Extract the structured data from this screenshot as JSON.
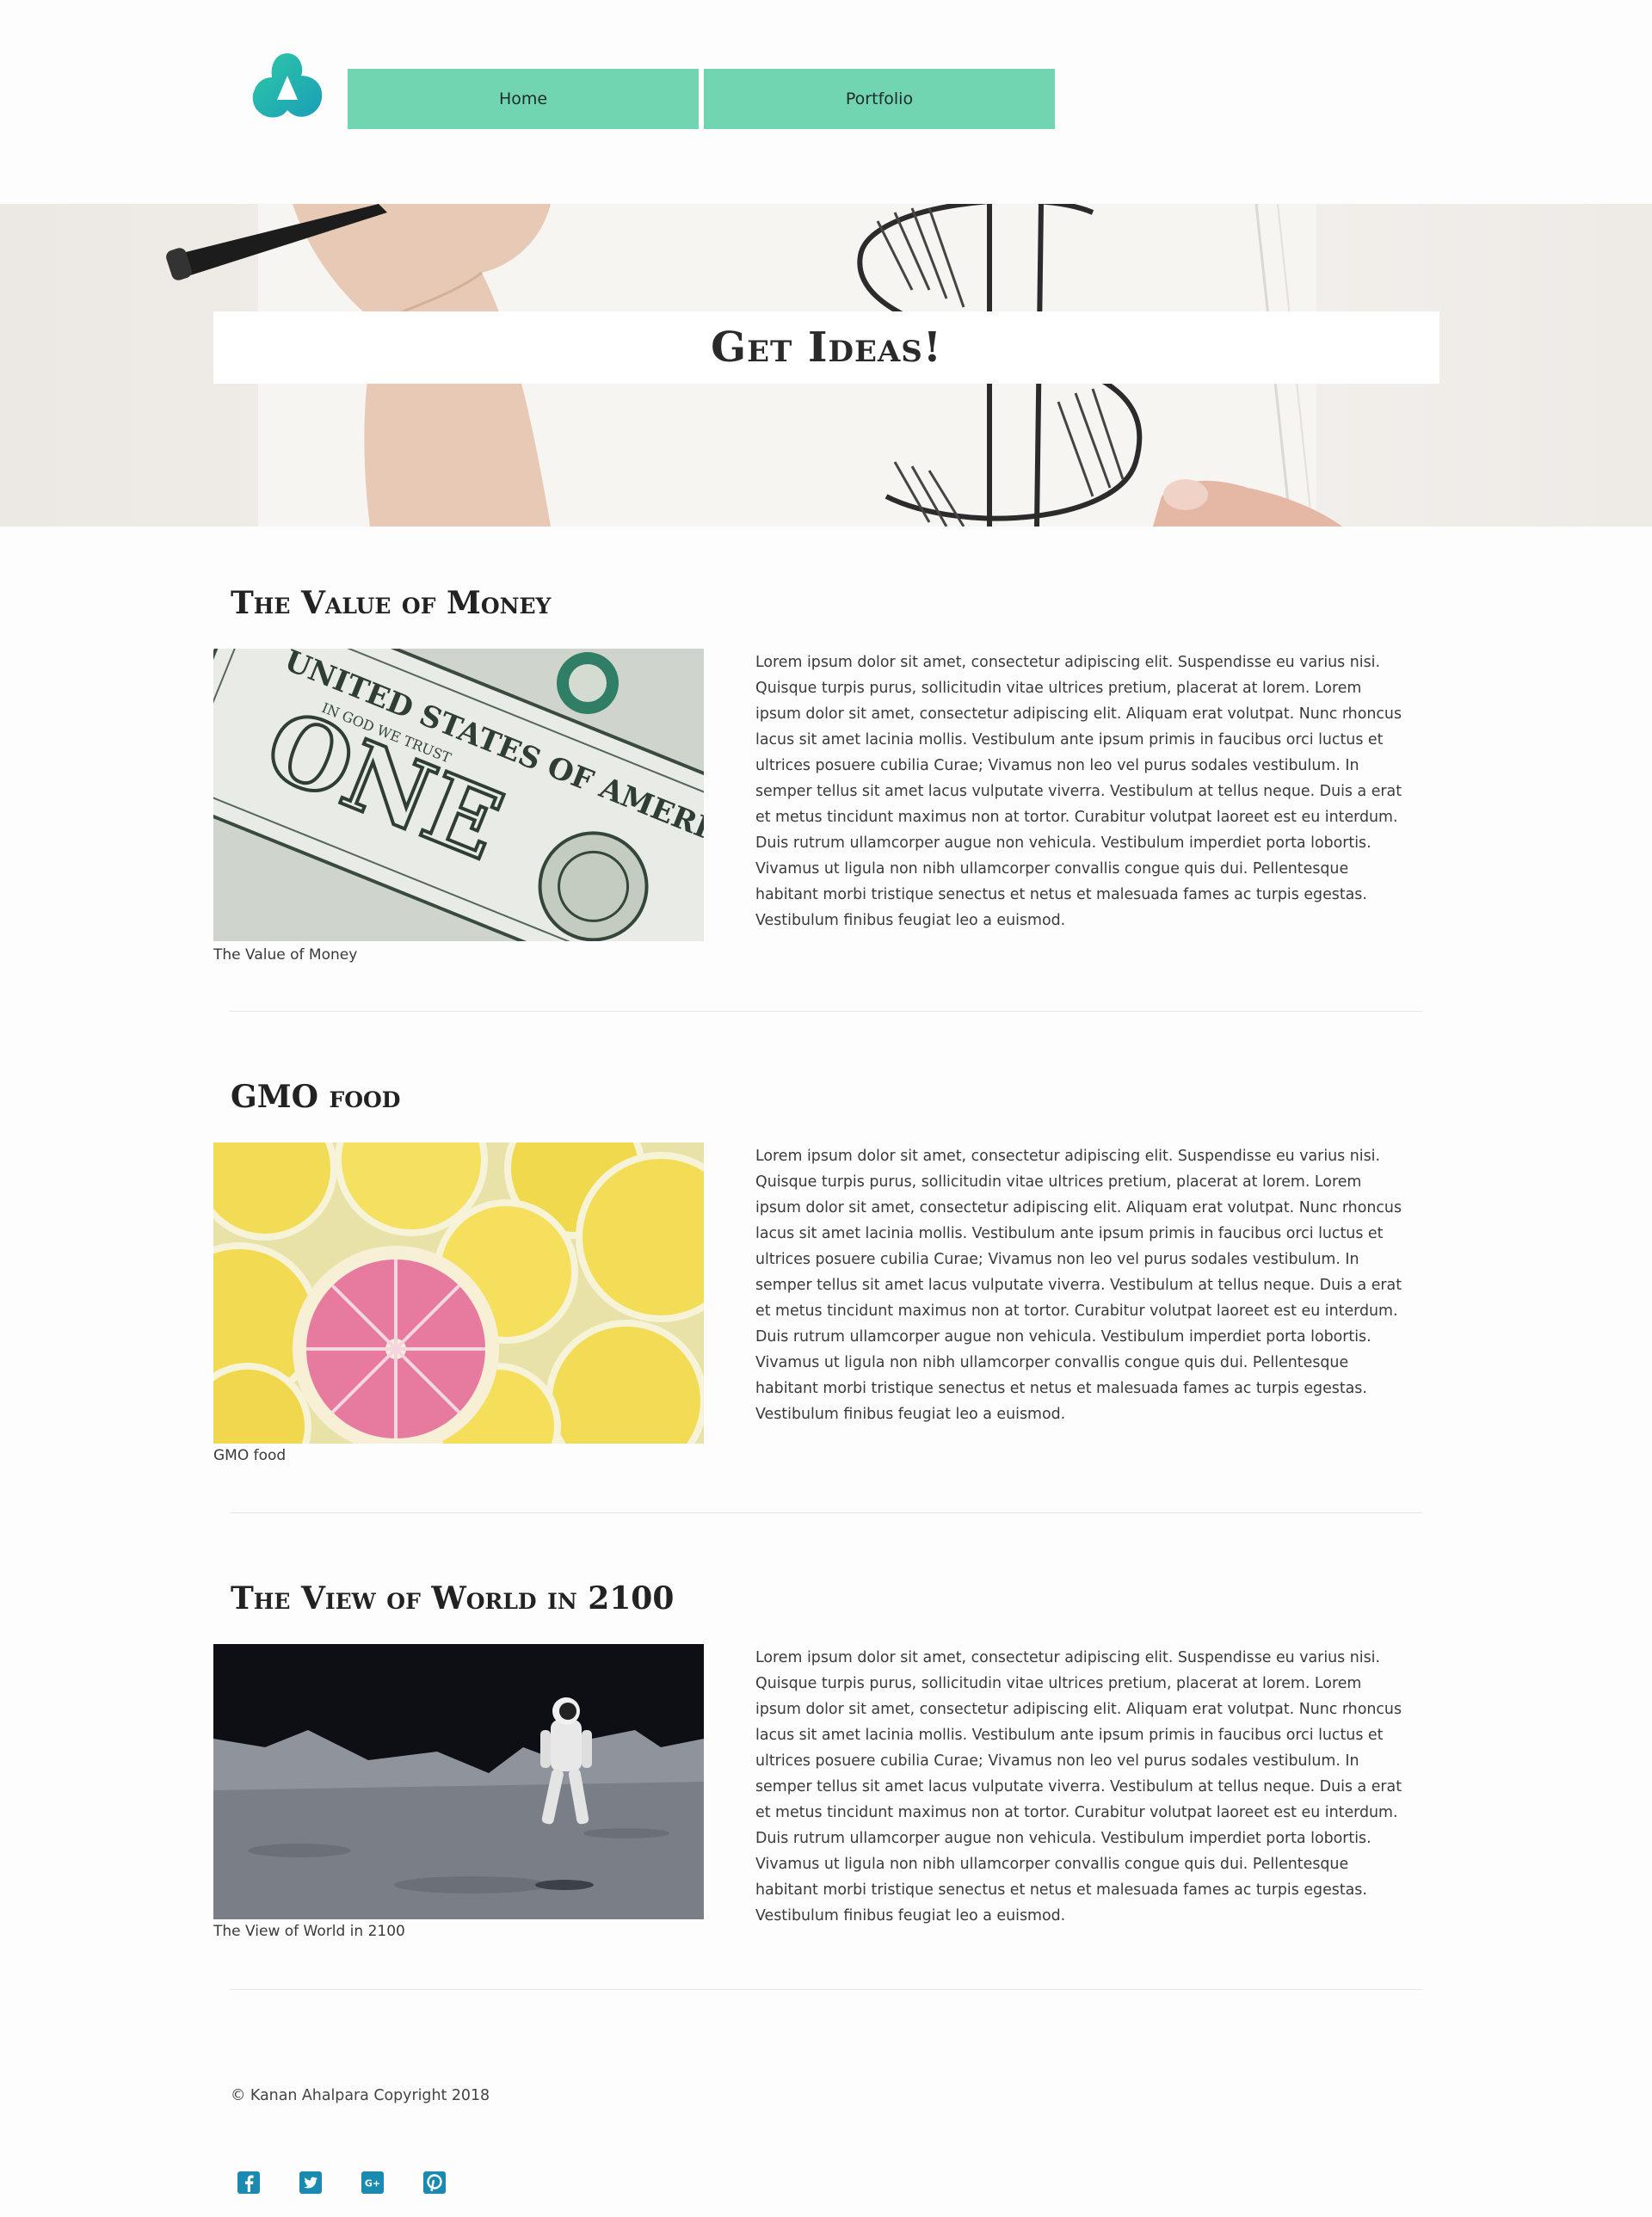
{
  "header": {
    "logo_icon": "droplet-trefoil-logo-icon",
    "nav": [
      {
        "label": "Home"
      },
      {
        "label": "Portfolio"
      }
    ]
  },
  "hero": {
    "title": "Get Ideas!",
    "background_icon": "dollar-sign-sketch-image"
  },
  "articles": [
    {
      "title": "The Value of Money",
      "image": "dollar-bill-photo",
      "caption": "The Value of Money",
      "body": "Lorem ipsum dolor sit amet, consectetur adipiscing elit. Suspendisse eu varius nisi. Quisque turpis purus, sollicitudin vitae ultrices pretium, placerat at lorem. Lorem ipsum dolor sit amet, consectetur adipiscing elit. Aliquam erat volutpat. Nunc rhoncus lacus sit amet lacinia mollis. Vestibulum ante ipsum primis in faucibus orci luctus et ultrices posuere cubilia Curae; Vivamus non leo vel purus sodales vestibulum. In semper tellus sit amet lacus vulputate viverra. Vestibulum at tellus neque. Duis a erat et metus tincidunt maximus non at tortor. Curabitur volutpat laoreet est eu interdum. Duis rutrum ullamcorper augue non vehicula. Vestibulum imperdiet porta lobortis. Vivamus ut ligula non nibh ullamcorper convallis congue quis dui. Pellentesque habitant morbi tristique senectus et netus et malesuada fames ac turpis egestas. Vestibulum finibus feugiat leo a euismod."
    },
    {
      "title": "GMO food",
      "image": "lemon-slices-photo",
      "caption": "GMO food",
      "body": "Lorem ipsum dolor sit amet, consectetur adipiscing elit. Suspendisse eu varius nisi. Quisque turpis purus, sollicitudin vitae ultrices pretium, placerat at lorem. Lorem ipsum dolor sit amet, consectetur adipiscing elit. Aliquam erat volutpat. Nunc rhoncus lacus sit amet lacinia mollis. Vestibulum ante ipsum primis in faucibus orci luctus et ultrices posuere cubilia Curae; Vivamus non leo vel purus sodales vestibulum. In semper tellus sit amet lacus vulputate viverra. Vestibulum at tellus neque. Duis a erat et metus tincidunt maximus non at tortor. Curabitur volutpat laoreet est eu interdum. Duis rutrum ullamcorper augue non vehicula. Vestibulum imperdiet porta lobortis. Vivamus ut ligula non nibh ullamcorper convallis congue quis dui. Pellentesque habitant morbi tristique senectus et netus et malesuada fames ac turpis egestas. Vestibulum finibus feugiat leo a euismod."
    },
    {
      "title": "The View of World in 2100",
      "image": "astronaut-moon-photo",
      "caption": "The View of World in 2100",
      "body": "Lorem ipsum dolor sit amet, consectetur adipiscing elit. Suspendisse eu varius nisi. Quisque turpis purus, sollicitudin vitae ultrices pretium, placerat at lorem. Lorem ipsum dolor sit amet, consectetur adipiscing elit. Aliquam erat volutpat. Nunc rhoncus lacus sit amet lacinia mollis. Vestibulum ante ipsum primis in faucibus orci luctus et ultrices posuere cubilia Curae; Vivamus non leo vel purus sodales vestibulum. In semper tellus sit amet lacus vulputate viverra. Vestibulum at tellus neque. Duis a erat et metus tincidunt maximus non at tortor. Curabitur volutpat laoreet est eu interdum. Duis rutrum ullamcorper augue non vehicula. Vestibulum imperdiet porta lobortis. Vivamus ut ligula non nibh ullamcorper convallis congue quis dui. Pellentesque habitant morbi tristique senectus et netus et malesuada fames ac turpis egestas. Vestibulum finibus feugiat leo a euismod."
    }
  ],
  "footer": {
    "copyright": "© Kanan Ahalpara Copyright 2018",
    "social": [
      {
        "icon": "facebook-icon"
      },
      {
        "icon": "twitter-icon"
      },
      {
        "icon": "google-plus-icon"
      },
      {
        "icon": "pinterest-icon"
      }
    ]
  },
  "colors": {
    "accent": "#71d5b2",
    "logo_teal": "#1fb5b0",
    "social_icon": "#1a8ab0",
    "background": "#fdfdfd"
  }
}
